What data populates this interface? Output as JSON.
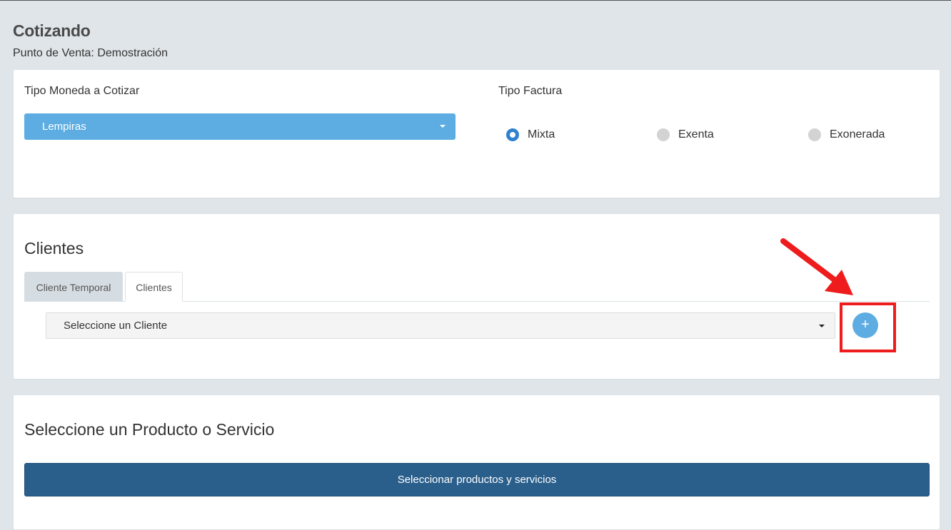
{
  "header": {
    "title": "Cotizando",
    "subtitle": "Punto de Venta: Demostración"
  },
  "currency": {
    "label": "Tipo Moneda a Cotizar",
    "selected": "Lempiras"
  },
  "invoice_type": {
    "label": "Tipo Factura",
    "options": [
      {
        "label": "Mixta",
        "checked": true
      },
      {
        "label": "Exenta",
        "checked": false
      },
      {
        "label": "Exonerada",
        "checked": false
      }
    ]
  },
  "clients": {
    "title": "Clientes",
    "tabs": [
      {
        "label": "Cliente Temporal",
        "active": false
      },
      {
        "label": "Clientes",
        "active": true
      }
    ],
    "select_placeholder": "Seleccione un Cliente",
    "add_button_label": "+"
  },
  "products": {
    "title": "Seleccione un Producto o Servicio",
    "button_label": "Seleccionar productos y servicios"
  },
  "colors": {
    "background": "#e0e5e9",
    "accent_blue": "#5dade2",
    "primary_dark": "#2a5f8c",
    "radio_active": "#2f80cf",
    "annotation_red": "#ee1c1c"
  }
}
